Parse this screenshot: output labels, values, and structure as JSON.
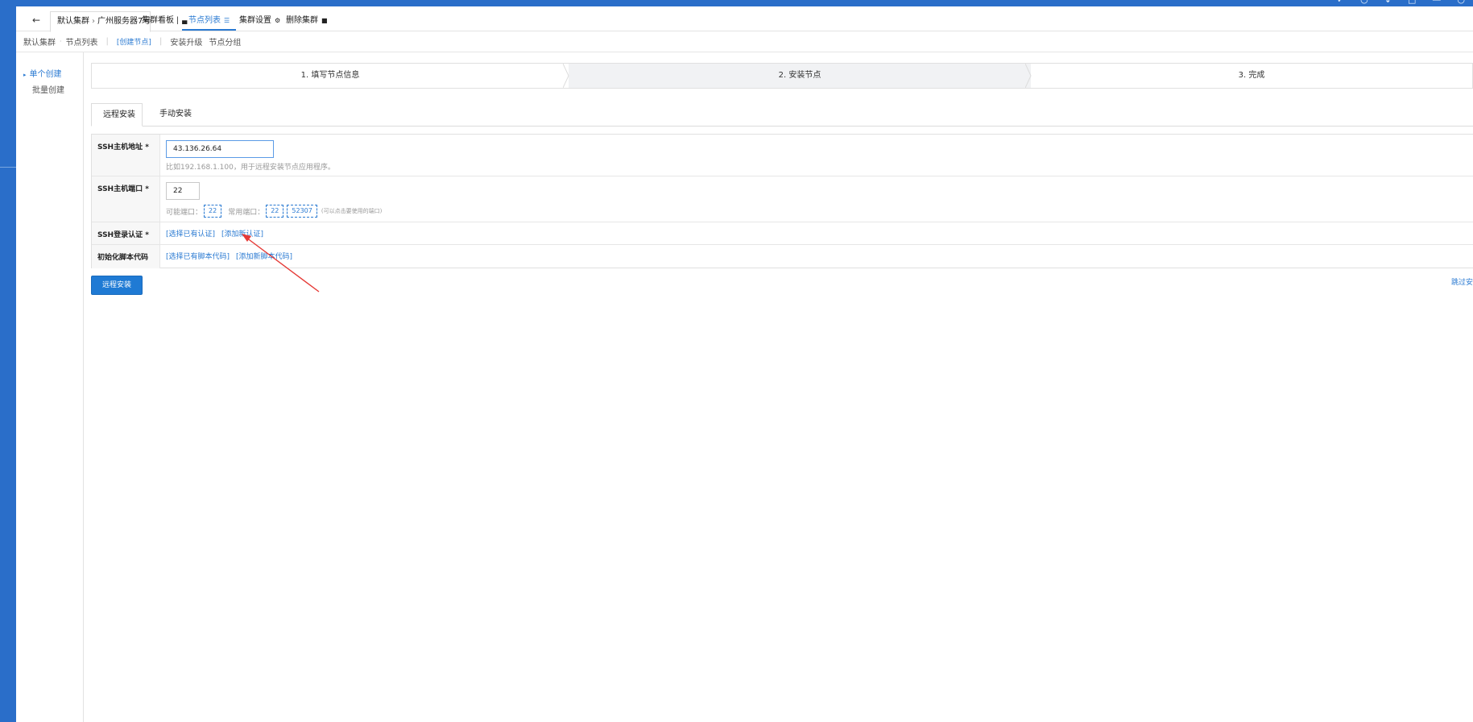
{
  "header": {
    "back_icon": "←",
    "crumb_cluster": "默认集群",
    "crumb_sep": "›",
    "crumb_server": "广州服务器7号",
    "tabs": [
      {
        "label": "集群看板",
        "icon": "▏▄"
      },
      {
        "label": "节点列表",
        "icon": "☰"
      },
      {
        "label": "集群设置",
        "icon": "⚙"
      },
      {
        "label": "删除集群",
        "icon": "■"
      }
    ]
  },
  "subnav": {
    "cluster": "默认集群",
    "dot": "·",
    "node_list": "节点列表",
    "bar": "|",
    "create": "[创建节点]",
    "upgrade": "安装升级",
    "group": "节点分组"
  },
  "sidemenu": {
    "arrow": "▸",
    "single": "单个创建",
    "batch": "批量创建"
  },
  "steps": [
    "1. 填写节点信息",
    "2. 安装节点",
    "3. 完成"
  ],
  "install_tabs": {
    "remote": "远程安装",
    "manual": "手动安装"
  },
  "form": {
    "ssh_host": {
      "label": "SSH主机地址 *",
      "value": "43.136.26.64",
      "hint": "比如192.168.1.100，用于远程安装节点应用程序。"
    },
    "ssh_port": {
      "label": "SSH主机端口 *",
      "value": "22",
      "possible_label": "可能端口：",
      "possible_ports": [
        "22"
      ],
      "common_label": "常用端口：",
      "common_ports": [
        "22",
        "52307"
      ],
      "note": "(可以点击要使用的端口)"
    },
    "ssh_auth": {
      "label": "SSH登录认证 *",
      "select_existing": "[选择已有认证]",
      "add_new": "[添加新认证]"
    },
    "init_script": {
      "label": "初始化脚本代码",
      "select_existing": "[选择已有脚本代码]",
      "add_new": "[添加新脚本代码]"
    }
  },
  "actions": {
    "install_button": "远程安装",
    "skip_link": "跳过安"
  },
  "colors": {
    "accent": "#2a7ad2",
    "frame": "#2a6ec9",
    "annotation_arrow": "#e53935"
  }
}
